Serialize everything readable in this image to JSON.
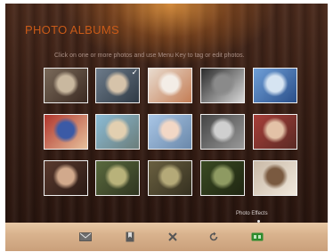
{
  "title": "PHOTO ALBUMS",
  "hint": "Click on one or more photos and use Menu Key to tag or edit photos.",
  "effects_label": "Photo Effects",
  "thumbnails": [
    {
      "name": "photo-1",
      "colors": [
        "#7a6a5a",
        "#c9b89f",
        "#3b2a22"
      ]
    },
    {
      "name": "photo-2",
      "colors": [
        "#6d7b8a",
        "#d6c3aa",
        "#2f3a45"
      ],
      "checked": true
    },
    {
      "name": "photo-3",
      "colors": [
        "#e9dccf",
        "#f3ede6",
        "#c47d55"
      ]
    },
    {
      "name": "photo-4",
      "colors": [
        "#2b2b2b",
        "#8a8a8a",
        "#d8d8d8"
      ]
    },
    {
      "name": "photo-5",
      "colors": [
        "#6f9fd8",
        "#d6e4f2",
        "#2a4f8a"
      ]
    },
    {
      "name": "photo-6",
      "colors": [
        "#b0352c",
        "#3b5aa6",
        "#e7c19c"
      ]
    },
    {
      "name": "photo-7",
      "colors": [
        "#8bbcd6",
        "#e2cfb0",
        "#6b7d7a"
      ]
    },
    {
      "name": "photo-8",
      "colors": [
        "#a9c6e6",
        "#f2d7c5",
        "#6a88aa"
      ]
    },
    {
      "name": "photo-9",
      "colors": [
        "#444444",
        "#cfcfcf",
        "#9a9a9a"
      ]
    },
    {
      "name": "photo-10",
      "colors": [
        "#a83f3a",
        "#e3c2a7",
        "#5a2a24"
      ]
    },
    {
      "name": "photo-11",
      "colors": [
        "#5a3a2e",
        "#d1a98c",
        "#2a1a15"
      ]
    },
    {
      "name": "photo-12",
      "colors": [
        "#5a6a3e",
        "#b8b27a",
        "#2f3520"
      ]
    },
    {
      "name": "photo-13",
      "colors": [
        "#6a6040",
        "#b4a978",
        "#353020"
      ]
    },
    {
      "name": "photo-14",
      "colors": [
        "#3a4a22",
        "#8e9a62",
        "#1f2612"
      ]
    },
    {
      "name": "photo-15",
      "colors": [
        "#c9b9a6",
        "#7a5a40",
        "#f0e8dc"
      ]
    }
  ],
  "toolbar": {
    "icons": [
      "email-icon",
      "bookmark-icon",
      "delete-icon",
      "rotate-icon",
      "slideshow-icon"
    ],
    "colors": {
      "email": "#6d6d6d",
      "bookmark": "#555555",
      "delete": "#555555",
      "rotate": "#555555",
      "slideshow": "#2e8b2e"
    }
  }
}
